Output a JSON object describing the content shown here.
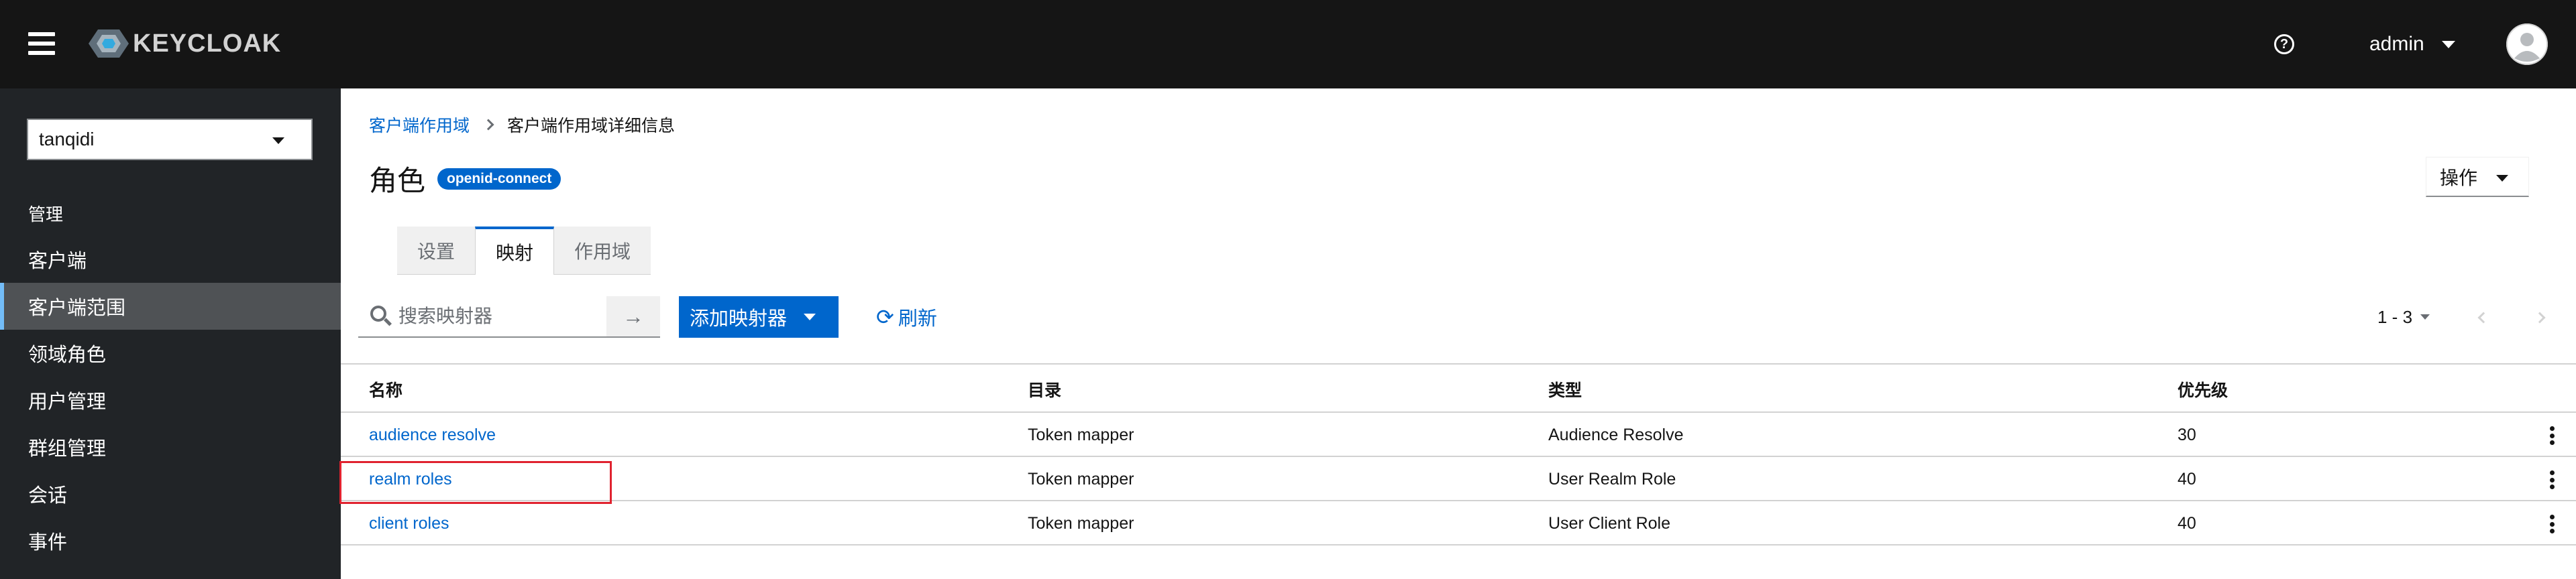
{
  "header": {
    "logo_text": "KEYCLOAK",
    "help_glyph": "?",
    "username": "admin"
  },
  "sidebar": {
    "realm": "tanqidi",
    "section_label": "管理",
    "items": [
      {
        "label": "客户端"
      },
      {
        "label": "客户端范围",
        "active": true
      },
      {
        "label": "领域角色"
      },
      {
        "label": "用户管理"
      },
      {
        "label": "群组管理"
      },
      {
        "label": "会话"
      },
      {
        "label": "事件"
      }
    ]
  },
  "breadcrumb": {
    "parent": "客户端作用域",
    "current": "客户端作用域详细信息"
  },
  "page": {
    "title": "角色",
    "badge": "openid-connect",
    "action_label": "操作"
  },
  "tabs": [
    {
      "label": "设置"
    },
    {
      "label": "映射",
      "active": true
    },
    {
      "label": "作用域"
    }
  ],
  "toolbar": {
    "search_placeholder": "搜索映射器",
    "add_mapper_label": "添加映射器",
    "refresh_label": "刷新",
    "pagination": "1 - 3"
  },
  "table": {
    "columns": [
      "名称",
      "目录",
      "类型",
      "优先级"
    ],
    "rows": [
      {
        "name": "audience resolve",
        "category": "Token mapper",
        "type": "Audience Resolve",
        "priority": "30"
      },
      {
        "name": "realm roles",
        "category": "Token mapper",
        "type": "User Realm Role",
        "priority": "40"
      },
      {
        "name": "client roles",
        "category": "Token mapper",
        "type": "User Client Role",
        "priority": "40"
      }
    ]
  },
  "colors": {
    "header_bg": "#151515",
    "sidebar_bg": "#212427",
    "accent": "#0066cc",
    "highlight": "#e0222f"
  },
  "icons": {
    "menu": "hamburger-icon",
    "help": "help-circle-icon",
    "search": "search-icon",
    "go": "arrow-right-icon",
    "refresh": "sync-icon",
    "row_actions": "kebab-icon"
  }
}
